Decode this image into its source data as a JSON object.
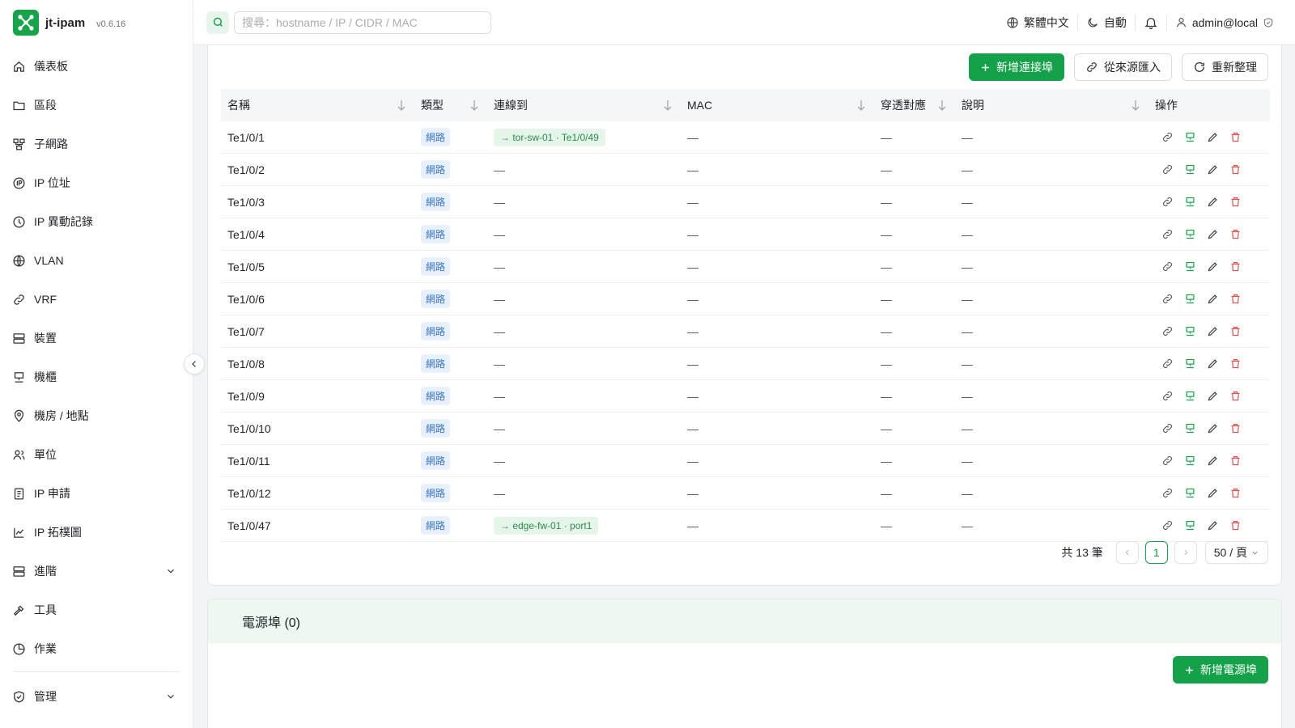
{
  "brand": {
    "name": "jt-ipam",
    "version": "v0.6.16",
    "color": "#16a34a"
  },
  "sidebar": {
    "items": [
      {
        "label": "儀表板",
        "icon": "home-icon"
      },
      {
        "label": "區段",
        "icon": "folder-icon"
      },
      {
        "label": "子網路",
        "icon": "network-icon"
      },
      {
        "label": "IP 位址",
        "icon": "ip-icon"
      },
      {
        "label": "IP 異動記錄",
        "icon": "history-icon"
      },
      {
        "label": "VLAN",
        "icon": "globe-icon"
      },
      {
        "label": "VRF",
        "icon": "link-icon"
      },
      {
        "label": "裝置",
        "icon": "server-icon"
      },
      {
        "label": "機櫃",
        "icon": "rack-icon"
      },
      {
        "label": "機房 / 地點",
        "icon": "location-icon"
      },
      {
        "label": "單位",
        "icon": "users-icon"
      },
      {
        "label": "IP 申請",
        "icon": "request-icon"
      },
      {
        "label": "IP 拓樸圖",
        "icon": "chart-icon"
      },
      {
        "label": "進階",
        "icon": "server-icon",
        "expandable": true
      },
      {
        "label": "工具",
        "icon": "hammer-icon"
      },
      {
        "label": "作業",
        "icon": "job-icon"
      }
    ],
    "admin": {
      "label": "管理",
      "icon": "shield-icon",
      "expandable": true
    }
  },
  "header": {
    "search_placeholder": "搜尋：hostname / IP / CIDR / MAC",
    "language": "繁體中文",
    "theme": "自動",
    "user": "admin@local"
  },
  "toolbar": {
    "add_label": "新增連接埠",
    "import_label": "從來源匯入",
    "refresh_label": "重新整理"
  },
  "table": {
    "columns": [
      "名稱",
      "類型",
      "連線到",
      "MAC",
      "穿透對應",
      "說明",
      "操作"
    ],
    "rows": [
      {
        "name": "Te1/0/1",
        "type": "網路",
        "conn": "→ tor-sw-01 · Te1/0/49",
        "mac": "—",
        "pass": "—",
        "desc": "—"
      },
      {
        "name": "Te1/0/2",
        "type": "網路",
        "conn": "—",
        "mac": "—",
        "pass": "—",
        "desc": "—"
      },
      {
        "name": "Te1/0/3",
        "type": "網路",
        "conn": "—",
        "mac": "—",
        "pass": "—",
        "desc": "—"
      },
      {
        "name": "Te1/0/4",
        "type": "網路",
        "conn": "—",
        "mac": "—",
        "pass": "—",
        "desc": "—"
      },
      {
        "name": "Te1/0/5",
        "type": "網路",
        "conn": "—",
        "mac": "—",
        "pass": "—",
        "desc": "—"
      },
      {
        "name": "Te1/0/6",
        "type": "網路",
        "conn": "—",
        "mac": "—",
        "pass": "—",
        "desc": "—"
      },
      {
        "name": "Te1/0/7",
        "type": "網路",
        "conn": "—",
        "mac": "—",
        "pass": "—",
        "desc": "—"
      },
      {
        "name": "Te1/0/8",
        "type": "網路",
        "conn": "—",
        "mac": "—",
        "pass": "—",
        "desc": "—"
      },
      {
        "name": "Te1/0/9",
        "type": "網路",
        "conn": "—",
        "mac": "—",
        "pass": "—",
        "desc": "—"
      },
      {
        "name": "Te1/0/10",
        "type": "網路",
        "conn": "—",
        "mac": "—",
        "pass": "—",
        "desc": "—"
      },
      {
        "name": "Te1/0/11",
        "type": "網路",
        "conn": "—",
        "mac": "—",
        "pass": "—",
        "desc": "—"
      },
      {
        "name": "Te1/0/12",
        "type": "網路",
        "conn": "—",
        "mac": "—",
        "pass": "—",
        "desc": "—"
      },
      {
        "name": "Te1/0/47",
        "type": "網路",
        "conn": "→ edge-fw-01 · port1",
        "mac": "—",
        "pass": "—",
        "desc": "—"
      }
    ]
  },
  "pagination": {
    "total": "共 13 筆",
    "current": "1",
    "page_size": "50 / 頁"
  },
  "power": {
    "title": "電源埠 (0)",
    "add_label": "新增電源埠"
  }
}
